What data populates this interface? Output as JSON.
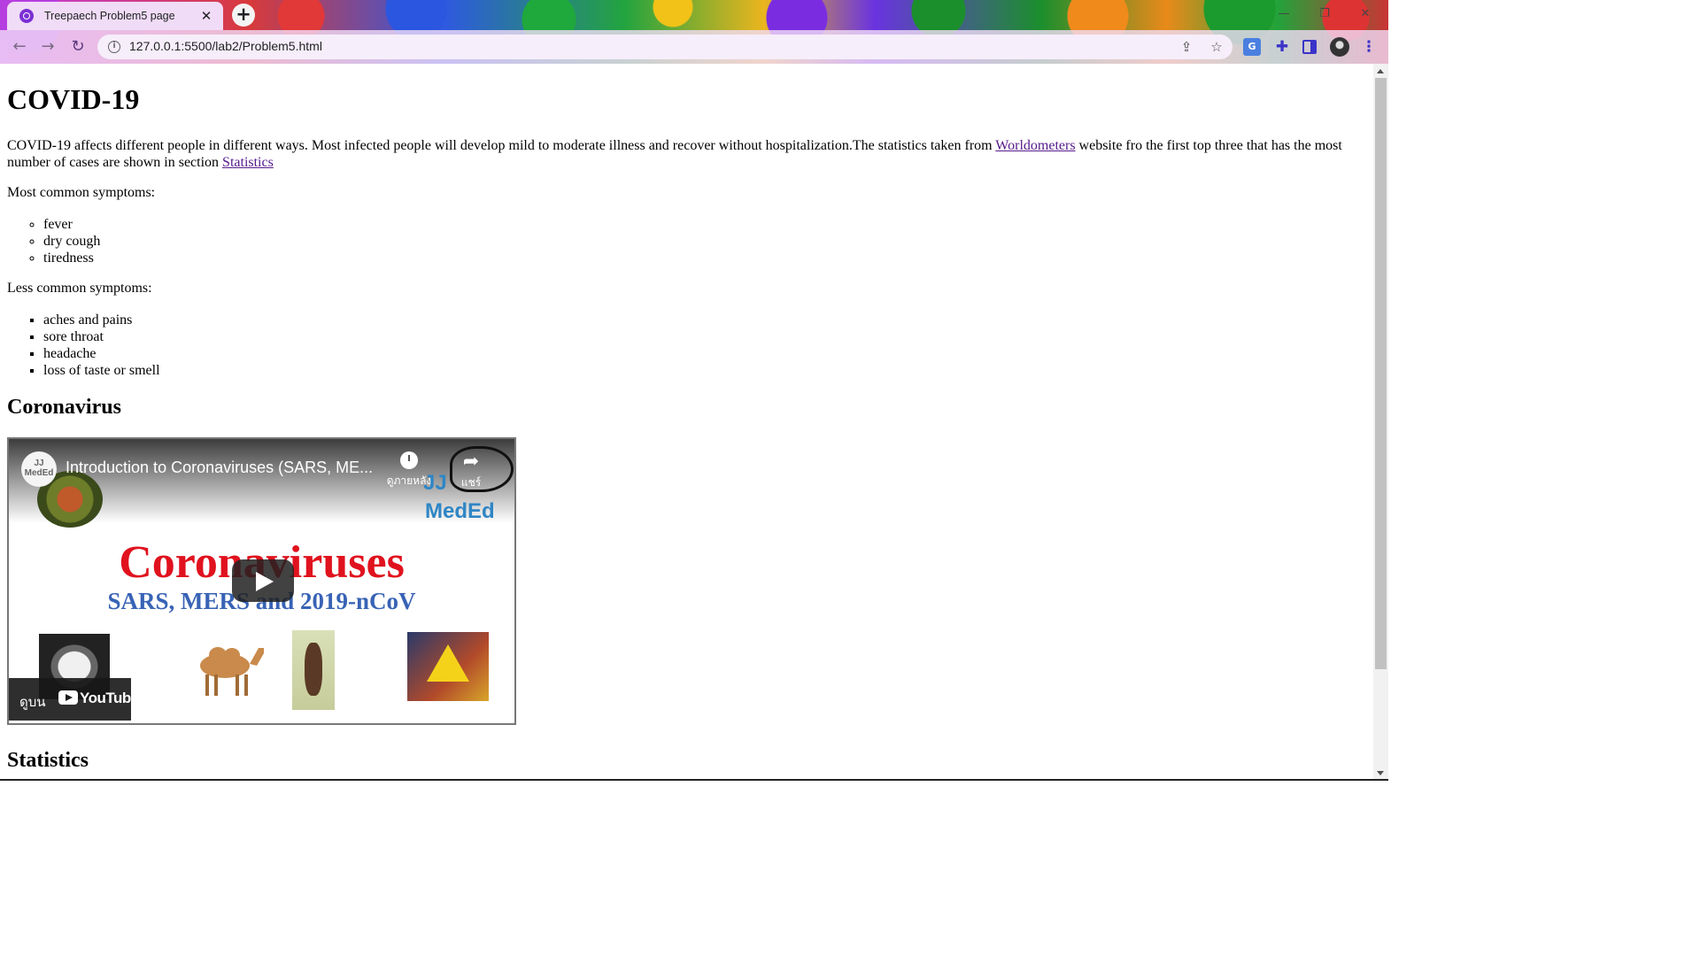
{
  "browser": {
    "tab_title": "Treepaech Problem5 page",
    "tab_close": "✕",
    "new_tab": "+",
    "url": "127.0.0.1:5500/lab2/Problem5.html",
    "window_controls": [
      "—",
      "❐",
      "✕"
    ],
    "nav": {
      "back": "←",
      "forward": "→",
      "reload": "↻"
    },
    "omnibox_icons": {
      "share": "⇪",
      "bookmark": "☆"
    },
    "toolbar_icons": [
      "translate-icon",
      "extensions-icon",
      "side-panel-icon",
      "profile-avatar",
      "menu-icon"
    ],
    "translate_text": "G",
    "menu_text": "⋮",
    "extension_text": "✚"
  },
  "page": {
    "title": "COVID-19",
    "intro_text": "COVID-19 affects different people in different ways. Most infected people will develop mild to moderate illness and recover without hospitalization.The statistics taken from ",
    "intro_link": "Worldometers",
    "intro_text_2": " website fro the first top three that has the most number of cases are shown in section ",
    "intro_link_2": "Statistics",
    "most_common_label": "Most common symptoms:",
    "most_common": [
      "fever",
      "dry cough",
      "tiredness"
    ],
    "less_common_label": "Less common symptoms:",
    "less_common": [
      "aches and pains",
      "sore throat",
      "headache",
      "loss of taste or smell"
    ],
    "coronavirus_heading": "Coronavirus",
    "statistics_heading": "Statistics"
  },
  "video": {
    "channel_badge": "JJ MedEd",
    "title": "Introduction to Coronaviruses (SARS, ME...",
    "watch_later": "ดูภายหลัง",
    "share": "แชร์",
    "logo_jj": "JJ",
    "logo_meded": "MedEd",
    "main_title": "Coronaviruses",
    "subtitle": "SARS, MERS and 2019-nCoV",
    "watch_on": "ดูบน",
    "youtube": "YouTube"
  }
}
